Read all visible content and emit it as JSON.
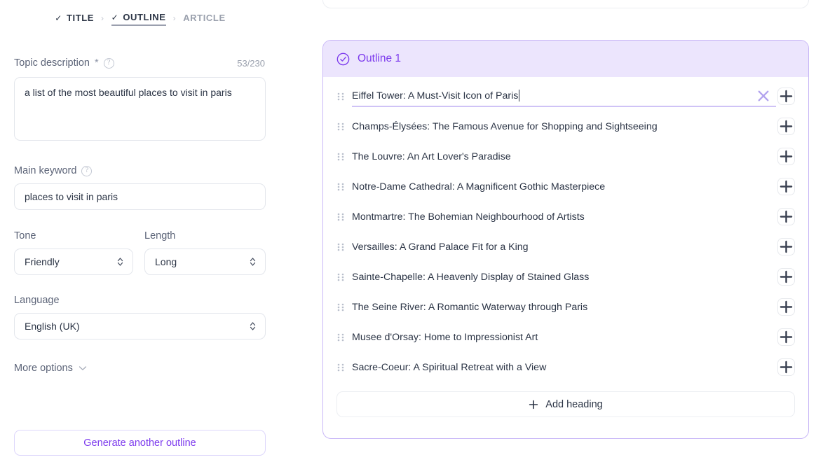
{
  "breadcrumb": {
    "steps": [
      {
        "label": "TITLE",
        "state": "done",
        "check": "✓"
      },
      {
        "label": "OUTLINE",
        "state": "active",
        "check": "✓"
      },
      {
        "label": "ARTICLE",
        "state": "todo",
        "check": ""
      }
    ],
    "separator": "›"
  },
  "form": {
    "topic_description": {
      "label": "Topic description",
      "required_marker": "*",
      "help": "?",
      "counter": "53/230",
      "value": "a list of the most beautiful places to visit in paris",
      "placeholder": ""
    },
    "main_keyword": {
      "label": "Main keyword",
      "help": "?",
      "value": "places to visit in paris",
      "placeholder": ""
    },
    "tone": {
      "label": "Tone",
      "value": "Friendly"
    },
    "length": {
      "label": "Length",
      "value": "Long"
    },
    "language": {
      "label": "Language",
      "value": "English (UK)"
    },
    "more_options_label": "More options",
    "generate_button": "Generate another outline"
  },
  "outline": {
    "title": "Outline 1",
    "selected": true,
    "headings": [
      "Eiffel Tower: A Must-Visit Icon of Paris",
      "Champs-Élysées: The Famous Avenue for Shopping and Sightseeing",
      "The Louvre: An Art Lover's Paradise",
      "Notre-Dame Cathedral: A Magnificent Gothic Masterpiece",
      "Montmartre: The Bohemian Neighbourhood of Artists",
      "Versailles: A Grand Palace Fit for a King",
      "Sainte-Chapelle: A Heavenly Display of Stained Glass",
      "The Seine River: A Romantic Waterway through Paris",
      "Musee d'Orsay: Home to Impressionist Art",
      "Sacre-Coeur: A Spiritual Retreat with a View"
    ],
    "editing_index": 0,
    "add_heading_label": "Add heading"
  },
  "colors": {
    "accent": "#7c3aed",
    "accent_light": "#ece5fd",
    "accent_border": "#c9b8f7",
    "text": "#2b3445",
    "muted": "#5c6478",
    "border": "#e3e6ec"
  }
}
